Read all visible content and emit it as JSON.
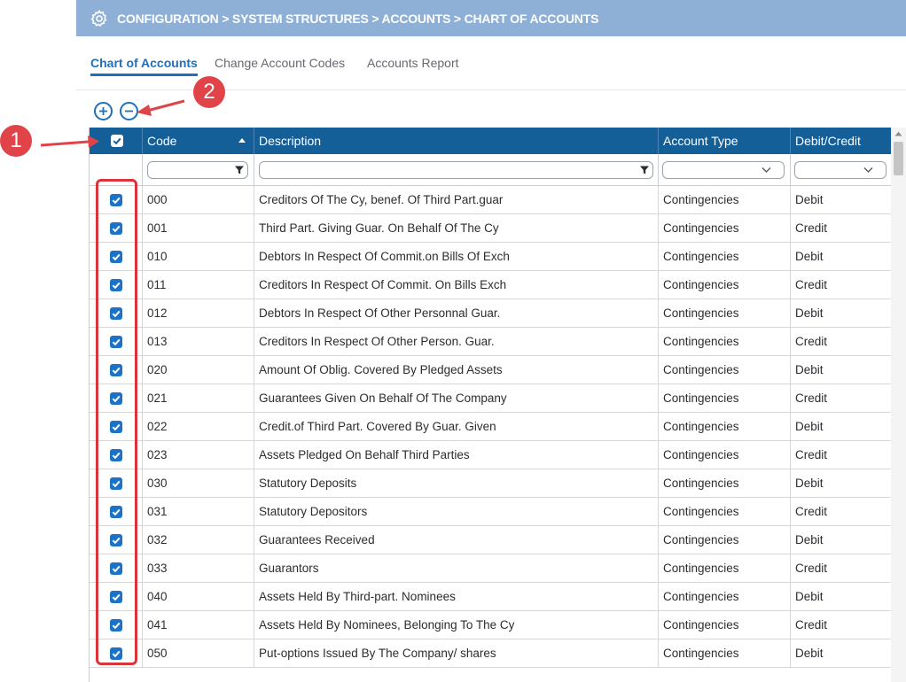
{
  "breadcrumb": {
    "icon": "gear-icon",
    "text": "CONFIGURATION > SYSTEM STRUCTURES > ACCOUNTS > CHART OF ACCOUNTS"
  },
  "tabs": [
    {
      "label": "Chart of Accounts",
      "active": true
    },
    {
      "label": "Change Account Codes",
      "active": false
    },
    {
      "label": "Accounts Report",
      "active": false
    }
  ],
  "toolbar": {
    "add_icon": "plus-circle-icon",
    "remove_icon": "minus-circle-icon"
  },
  "annotations": {
    "badge_1": "1",
    "badge_2": "2"
  },
  "table": {
    "columns": {
      "code": "Code",
      "description": "Description",
      "account_type": "Account Type",
      "debit_credit": "Debit/Credit"
    },
    "sort": {
      "column": "Code",
      "direction": "ascending"
    },
    "select_all_checked": true,
    "rows": [
      {
        "checked": true,
        "code": "000",
        "description": "Creditors Of The Cy, benef. Of Third Part.guar",
        "account_type": "Contingencies",
        "debit_credit": "Debit"
      },
      {
        "checked": true,
        "code": "001",
        "description": "Third Part. Giving Guar. On Behalf Of The Cy",
        "account_type": "Contingencies",
        "debit_credit": "Credit"
      },
      {
        "checked": true,
        "code": "010",
        "description": "Debtors In Respect Of Commit.on Bills Of Exch",
        "account_type": "Contingencies",
        "debit_credit": "Debit"
      },
      {
        "checked": true,
        "code": "011",
        "description": "Creditors In Respect Of Commit. On Bills Exch",
        "account_type": "Contingencies",
        "debit_credit": "Credit"
      },
      {
        "checked": true,
        "code": "012",
        "description": "Debtors In Respect Of Other Personnal Guar.",
        "account_type": "Contingencies",
        "debit_credit": "Debit"
      },
      {
        "checked": true,
        "code": "013",
        "description": "Creditors In Respect Of Other Person. Guar.",
        "account_type": "Contingencies",
        "debit_credit": "Credit"
      },
      {
        "checked": true,
        "code": "020",
        "description": "Amount Of Oblig. Covered By Pledged Assets",
        "account_type": "Contingencies",
        "debit_credit": "Debit"
      },
      {
        "checked": true,
        "code": "021",
        "description": "Guarantees Given On Behalf Of The Company",
        "account_type": "Contingencies",
        "debit_credit": "Credit"
      },
      {
        "checked": true,
        "code": "022",
        "description": "Credit.of Third Part. Covered By Guar. Given",
        "account_type": "Contingencies",
        "debit_credit": "Debit"
      },
      {
        "checked": true,
        "code": "023",
        "description": "Assets Pledged On Behalf Third Parties",
        "account_type": "Contingencies",
        "debit_credit": "Credit"
      },
      {
        "checked": true,
        "code": "030",
        "description": "Statutory Deposits",
        "account_type": "Contingencies",
        "debit_credit": "Debit"
      },
      {
        "checked": true,
        "code": "031",
        "description": "Statutory Depositors",
        "account_type": "Contingencies",
        "debit_credit": "Credit"
      },
      {
        "checked": true,
        "code": "032",
        "description": "Guarantees Received",
        "account_type": "Contingencies",
        "debit_credit": "Debit"
      },
      {
        "checked": true,
        "code": "033",
        "description": "Guarantors",
        "account_type": "Contingencies",
        "debit_credit": "Credit"
      },
      {
        "checked": true,
        "code": "040",
        "description": "Assets Held By Third-part. Nominees",
        "account_type": "Contingencies",
        "debit_credit": "Debit"
      },
      {
        "checked": true,
        "code": "041",
        "description": "Assets Held By Nominees, Belonging To The Cy",
        "account_type": "Contingencies",
        "debit_credit": "Credit"
      },
      {
        "checked": true,
        "code": "050",
        "description": "Put-options Issued By The Company/ shares",
        "account_type": "Contingencies",
        "debit_credit": "Debit"
      }
    ]
  }
}
